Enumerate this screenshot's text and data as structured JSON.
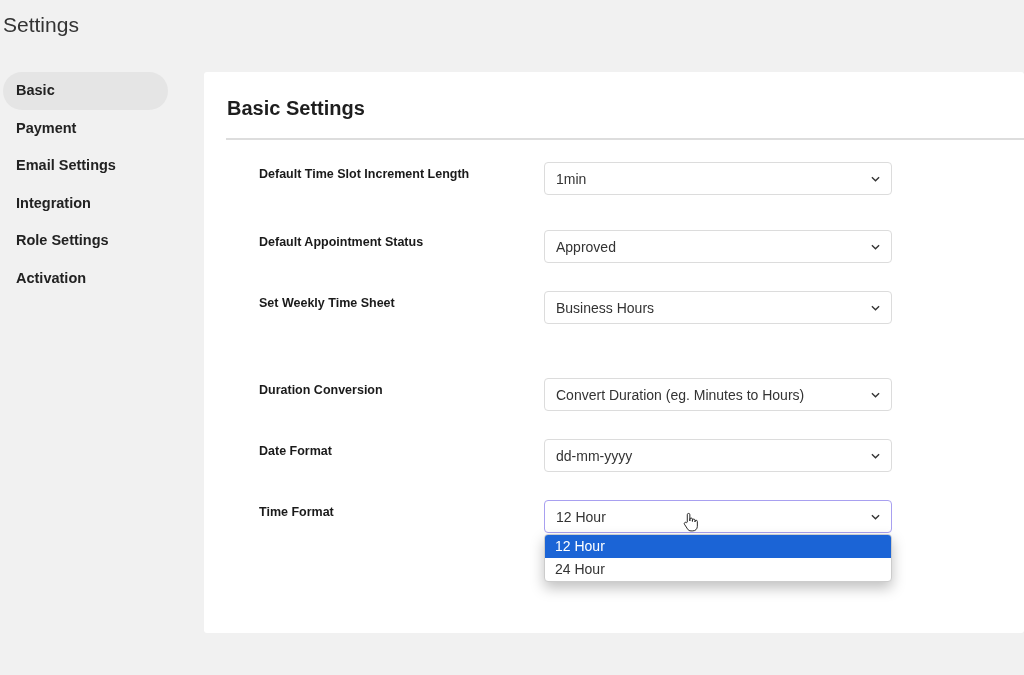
{
  "page_title": "Settings",
  "sidebar": {
    "items": [
      {
        "label": "Basic",
        "selected": true
      },
      {
        "label": "Payment",
        "selected": false
      },
      {
        "label": "Email Settings",
        "selected": false
      },
      {
        "label": "Integration",
        "selected": false
      },
      {
        "label": "Role Settings",
        "selected": false
      },
      {
        "label": "Activation",
        "selected": false
      }
    ]
  },
  "panel": {
    "heading": "Basic Settings",
    "fields": [
      {
        "label": "Default Time Slot Increment Length",
        "value": "1min",
        "open": false
      },
      {
        "label": "Default Appointment Status",
        "value": "Approved",
        "open": false
      },
      {
        "label": "Set Weekly Time Sheet",
        "value": "Business Hours",
        "open": false
      },
      {
        "label": "Duration Conversion",
        "value": "Convert Duration (eg. Minutes to Hours)",
        "open": false
      },
      {
        "label": "Date Format",
        "value": "dd-mm-yyyy",
        "open": false
      },
      {
        "label": "Time Format",
        "value": "12 Hour",
        "open": true,
        "options": [
          {
            "label": "12 Hour",
            "selected": true
          },
          {
            "label": "24 Hour",
            "selected": false
          }
        ]
      }
    ]
  }
}
